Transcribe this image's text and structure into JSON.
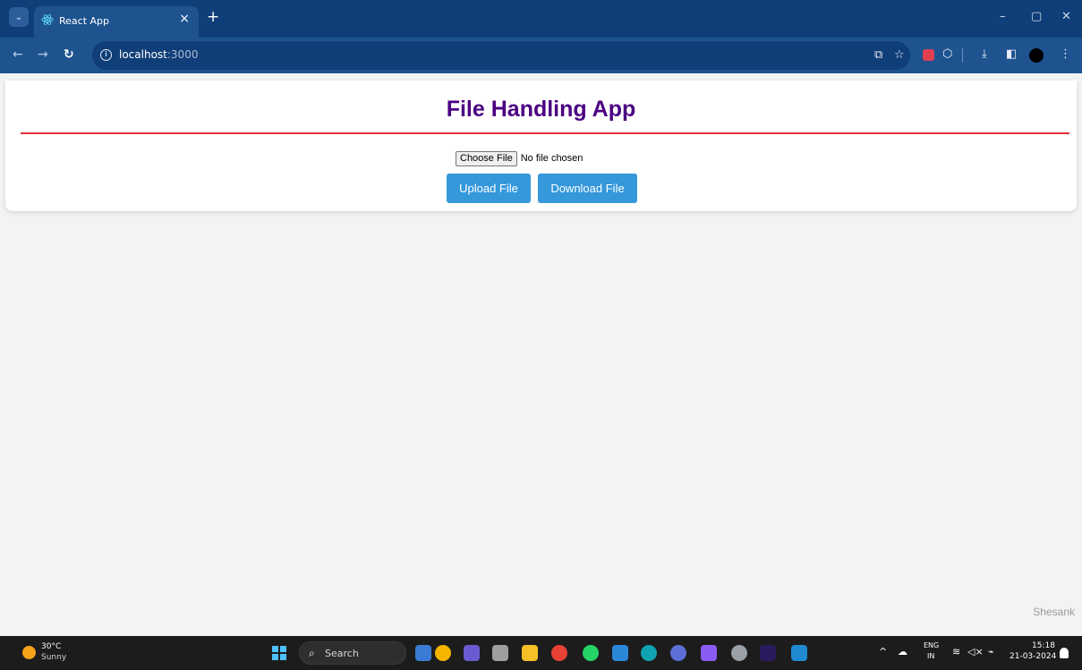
{
  "browser": {
    "tab_title": "React App",
    "tab_close": "×",
    "new_tab": "+",
    "url_host": "localhost",
    "url_port": ":3000",
    "window_controls": [
      "–",
      "▢",
      "✕"
    ]
  },
  "app": {
    "title": "File Handling App",
    "choose_file_label": "Choose File",
    "no_file_label": "No file chosen",
    "upload_label": "Upload File",
    "download_label": "Download File",
    "footer": "Shesank",
    "colors": {
      "title": "#4b0082",
      "rule": "#e0303a",
      "button": "#3498db"
    }
  },
  "taskbar": {
    "temperature": "30°C",
    "weather": "Sunny",
    "search_label": "Search",
    "language": "ENG",
    "region": "IN",
    "time": "15:18",
    "date": "21-03-2024"
  }
}
